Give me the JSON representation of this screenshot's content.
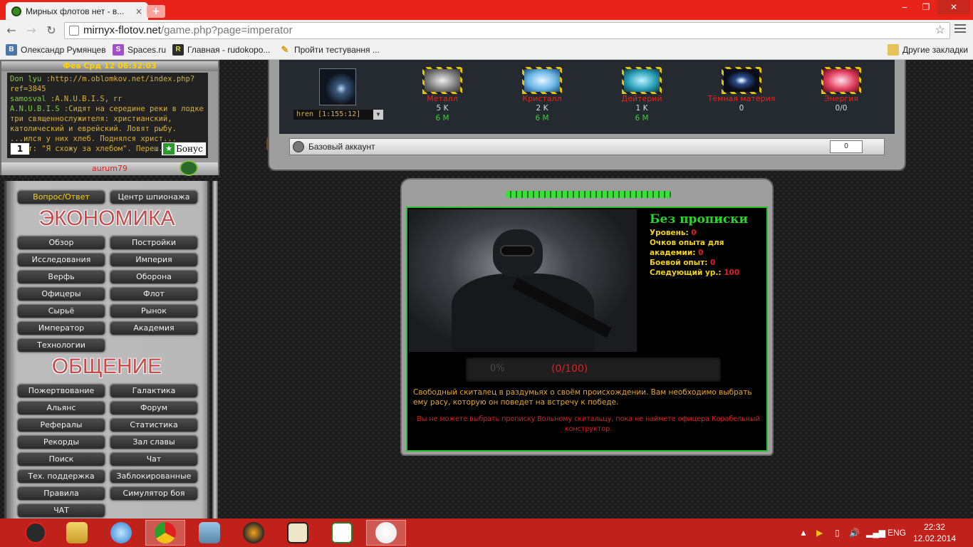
{
  "browser": {
    "tab_title": "Мирных флотов нет - в...",
    "tab_close": "×",
    "new_tab": "+",
    "url_host": "mirnyx-flotov.net",
    "url_path": "/game.php?page=imperator",
    "bookmarks": [
      {
        "icon": "В",
        "label": "Олександр Румянцев",
        "color": "#4a76a8"
      },
      {
        "icon": "S",
        "label": "Spaces.ru",
        "color": "#a34fc9"
      },
      {
        "icon": "R",
        "label": "Главная - rudokopo...",
        "color": "#2d2d2d"
      },
      {
        "icon": "✎",
        "label": "Пройти тестування ...",
        "color": "#d8a21c"
      }
    ],
    "other_bookmarks": "Другие закладки"
  },
  "chat": {
    "header": "Фев Срд 12 06:32:03",
    "lines": [
      {
        "nick": "Don lyu",
        "text": " :http://m.oblomkov.net/index.php?ref=3845"
      },
      {
        "nick": "samosval",
        "text": " :A.N.U.B.I.S, гг"
      },
      {
        "nick": "A.N.U.B.I.S",
        "text": " :Сидят на середине реки в лодке три священнослужителя: христианский, католический и еврейский. Ловят рыбу. ...ился у них хлеб. Поднялся христ... ...ит: \"Я схожу за хлебом\". Переш..."
      }
    ],
    "online_count": "1",
    "bonus_label": "Бонус",
    "username": "aurum79"
  },
  "menu": {
    "top_left": "Вопрос/Ответ",
    "top_right": "Центр шпионажа",
    "economy_title": "ЭКОНОМИКА",
    "economy": [
      "Обзор",
      "Постройки",
      "Исследования",
      "Империя",
      "Верфь",
      "Оборона",
      "Офицеры",
      "Флот",
      "Сырьё",
      "Рынок",
      "Император",
      "Академия",
      "Технологии"
    ],
    "social_title": "ОБЩЕНИЕ",
    "social": [
      "Пожертвование",
      "Галактика",
      "Альянс",
      "Форум",
      "Рефералы",
      "Статистика",
      "Рекорды",
      "Зал славы",
      "Поиск",
      "Чат",
      "Тех. поддержка",
      "Заблокированные",
      "Правила",
      "Симулятор боя",
      "ЧАТ"
    ]
  },
  "resources": {
    "planet_select": "hren [1:155:12]",
    "items": [
      {
        "name": "Металл",
        "amount": "5 K",
        "prod": "6 M",
        "color": "#c8c8c8"
      },
      {
        "name": "Кристалл",
        "amount": "2 K",
        "prod": "6 M",
        "color": "#8ad0ff"
      },
      {
        "name": "Дейтерий",
        "amount": "1 K",
        "prod": "6 M",
        "color": "#3ab0c8"
      },
      {
        "name": "Тёмная материя",
        "amount": "0",
        "prod": "",
        "color": "#1a3a6a"
      },
      {
        "name": "Энергия",
        "amount": "0/0",
        "prod": "",
        "color": "#e04060"
      }
    ],
    "account": "Базовый аккаунт",
    "account_counter": "0"
  },
  "emperor": {
    "title": "Без прописки",
    "stats": [
      {
        "label": "Уровень: ",
        "value": "0"
      },
      {
        "label": "Очков опыта для академии: ",
        "value": "0"
      },
      {
        "label": "Боевой опыт: ",
        "value": "0"
      },
      {
        "label": "Следующий ур.: ",
        "value": "100"
      }
    ],
    "progress_percent": "0%",
    "progress_fraction": "(0/100)",
    "progress_value": 0,
    "description": "Свободный скиталец в раздумьях о своём происхождении. Вам необходимо выбрать ему расу, которую он поведет на встречу к победе.",
    "warning": "Вы не можете выбрать прописку Вольному скитальцу, пока не наймете офицера Корабельный конструктор."
  },
  "taskbar": {
    "language": "ENG",
    "time": "22:32",
    "date": "12.02.2014"
  }
}
